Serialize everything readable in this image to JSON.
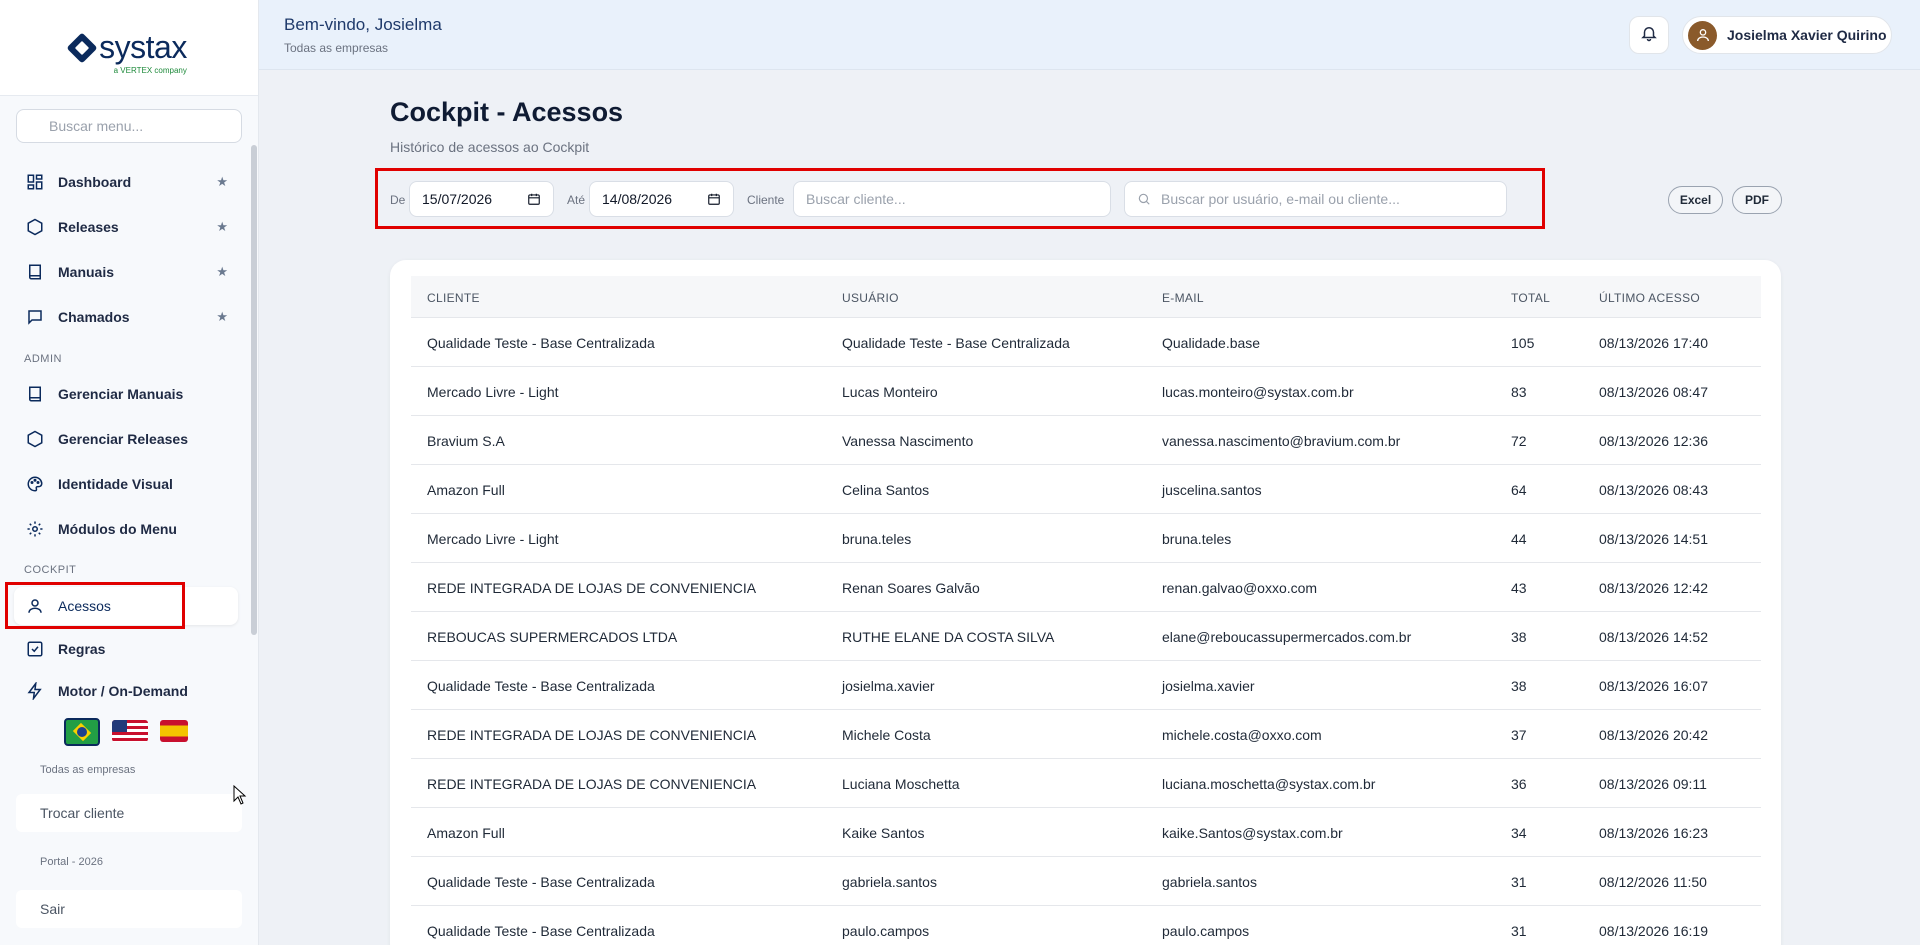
{
  "sidebar": {
    "logo_text": "systax",
    "logo_sub": "a VERTEX company",
    "search_placeholder": "Buscar menu...",
    "items_main": [
      {
        "label": "Dashboard"
      },
      {
        "label": "Releases"
      },
      {
        "label": "Manuais"
      },
      {
        "label": "Chamados"
      }
    ],
    "admin_title": "ADMIN",
    "items_admin": [
      {
        "label": "Gerenciar Manuais"
      },
      {
        "label": "Gerenciar Releases"
      },
      {
        "label": "Identidade Visual"
      },
      {
        "label": "Módulos do Menu"
      }
    ],
    "cockpit_title": "COCKPIT",
    "items_cockpit": [
      {
        "label": "Acessos"
      },
      {
        "label": "Regras"
      },
      {
        "label": "Motor / On-Demand"
      }
    ],
    "company_label": "Todas as empresas",
    "switch_client": "Trocar cliente",
    "portal_label": "Portal - 2026",
    "logout": "Sair"
  },
  "header": {
    "welcome": "Bem-vindo, Josielma",
    "company": "Todas as empresas",
    "user_name": "Josielma Xavier Quirino"
  },
  "page": {
    "title": "Cockpit - Acessos",
    "subtitle": "Histórico de acessos ao Cockpit"
  },
  "filters": {
    "from_label": "De",
    "from_value": "15/07/2026",
    "to_label": "Até",
    "to_value": "14/08/2026",
    "client_label": "Cliente",
    "client_placeholder": "Buscar cliente...",
    "search_placeholder": "Buscar por usuário, e-mail ou cliente...",
    "excel": "Excel",
    "pdf": "PDF"
  },
  "table": {
    "headers": [
      "CLIENTE",
      "USUÁRIO",
      "E-MAIL",
      "TOTAL",
      "ÚLTIMO ACESSO"
    ],
    "rows": [
      [
        "Qualidade Teste - Base Centralizada",
        "Qualidade Teste - Base Centralizada",
        "Qualidade.base",
        "105",
        "08/13/2026 17:40"
      ],
      [
        "Mercado Livre - Light",
        "Lucas Monteiro",
        "lucas.monteiro@systax.com.br",
        "83",
        "08/13/2026 08:47"
      ],
      [
        "Bravium S.A",
        "Vanessa Nascimento",
        "vanessa.nascimento@bravium.com.br",
        "72",
        "08/13/2026 12:36"
      ],
      [
        "Amazon Full",
        "Celina Santos",
        "juscelina.santos",
        "64",
        "08/13/2026 08:43"
      ],
      [
        "Mercado Livre - Light",
        "bruna.teles",
        "bruna.teles",
        "44",
        "08/13/2026 14:51"
      ],
      [
        "REDE INTEGRADA DE LOJAS DE CONVENIENCIA",
        "Renan Soares Galvão",
        "renan.galvao@oxxo.com",
        "43",
        "08/13/2026 12:42"
      ],
      [
        "REBOUCAS SUPERMERCADOS LTDA",
        "RUTHE ELANE DA COSTA SILVA",
        "elane@reboucassupermercados.com.br",
        "38",
        "08/13/2026 14:52"
      ],
      [
        "Qualidade Teste - Base Centralizada",
        "josielma.xavier",
        "josielma.xavier",
        "38",
        "08/13/2026 16:07"
      ],
      [
        "REDE INTEGRADA DE LOJAS DE CONVENIENCIA",
        "Michele Costa",
        "michele.costa@oxxo.com",
        "37",
        "08/13/2026 20:42"
      ],
      [
        "REDE INTEGRADA DE LOJAS DE CONVENIENCIA",
        "Luciana Moschetta",
        "luciana.moschetta@systax.com.br",
        "36",
        "08/13/2026 09:11"
      ],
      [
        "Amazon Full",
        "Kaike Santos",
        "kaike.Santos@systax.com.br",
        "34",
        "08/13/2026 16:23"
      ],
      [
        "Qualidade Teste - Base Centralizada",
        "gabriela.santos",
        "gabriela.santos",
        "31",
        "08/12/2026 11:50"
      ],
      [
        "Qualidade Teste - Base Centralizada",
        "paulo.campos",
        "paulo.campos",
        "31",
        "08/13/2026 16:19"
      ]
    ]
  },
  "colors": {
    "brand": "#0b2a5c",
    "highlight": "#e00000"
  }
}
